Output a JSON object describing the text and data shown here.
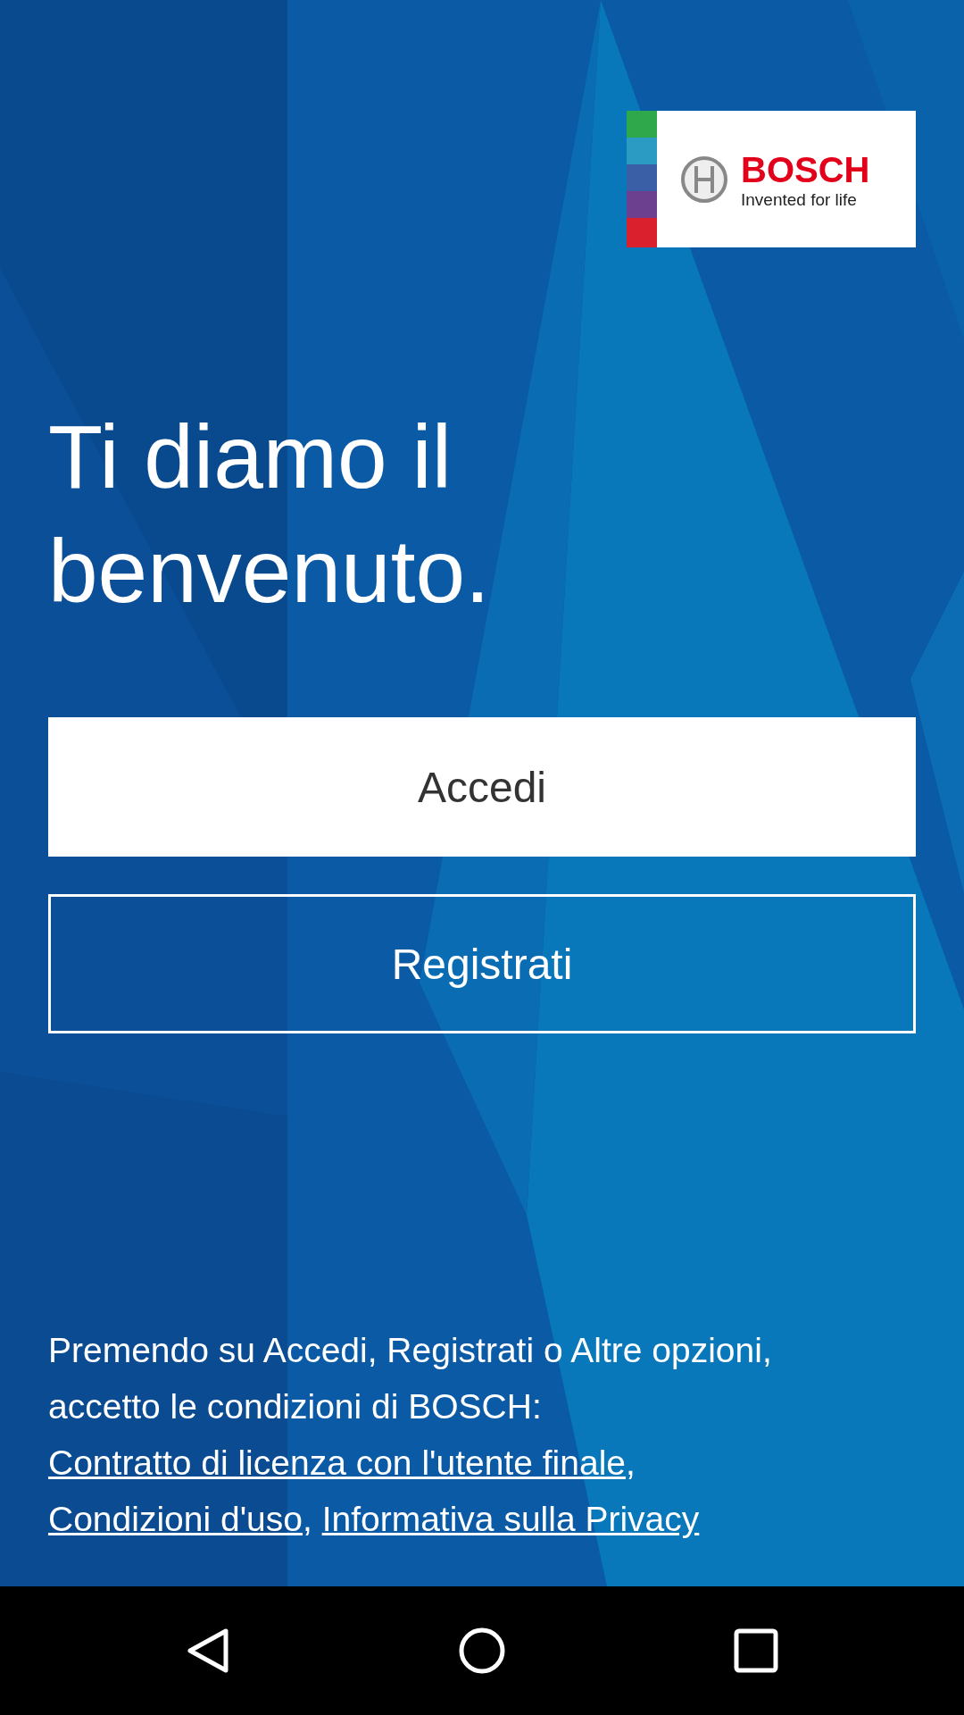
{
  "logo": {
    "brand": "BOSCH",
    "tagline": "Invented for life"
  },
  "headline": "Ti diamo il benvenuto.",
  "buttons": [
    {
      "label": "Accedi",
      "kind": "filled"
    },
    {
      "label": "Registrati",
      "kind": "outline"
    }
  ],
  "legal": [
    {
      "kind": "text",
      "text": "Premendo su Accedi, Registrati o Altre opzioni, accetto le condizioni di BOSCH: "
    },
    {
      "kind": "link",
      "text": "Contratto di licenza con l'utente finale"
    },
    {
      "kind": "text",
      "text": ", "
    },
    {
      "kind": "link",
      "text": "Condizioni d'uso"
    },
    {
      "kind": "text",
      "text": ", "
    },
    {
      "kind": "link",
      "text": "Informativa sulla Privacy"
    }
  ]
}
